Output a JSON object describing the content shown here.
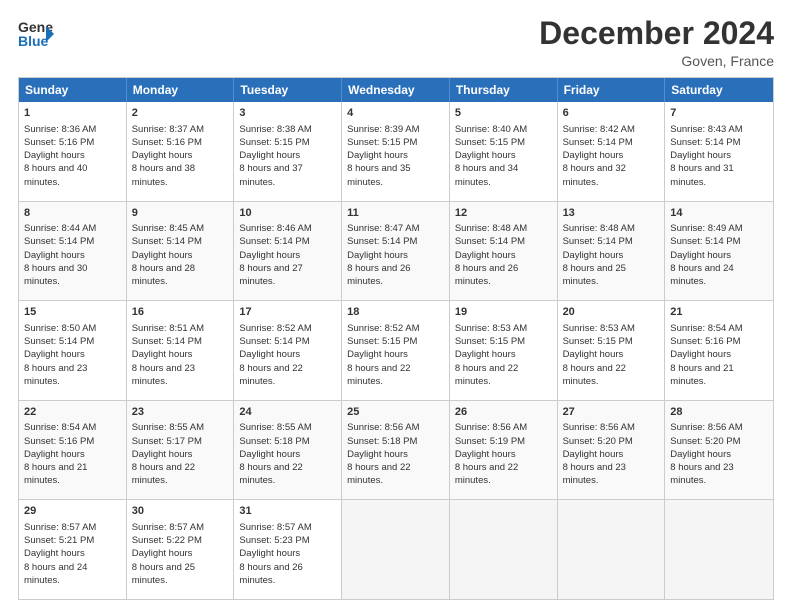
{
  "header": {
    "logo_line1": "General",
    "logo_line2": "Blue",
    "title": "December 2024",
    "location": "Goven, France"
  },
  "days": [
    "Sunday",
    "Monday",
    "Tuesday",
    "Wednesday",
    "Thursday",
    "Friday",
    "Saturday"
  ],
  "weeks": [
    [
      {
        "day": "1",
        "sun": "8:36 AM",
        "set": "5:16 PM",
        "daylight": "8 hours and 40 minutes."
      },
      {
        "day": "2",
        "sun": "8:37 AM",
        "set": "5:16 PM",
        "daylight": "8 hours and 38 minutes."
      },
      {
        "day": "3",
        "sun": "8:38 AM",
        "set": "5:15 PM",
        "daylight": "8 hours and 37 minutes."
      },
      {
        "day": "4",
        "sun": "8:39 AM",
        "set": "5:15 PM",
        "daylight": "8 hours and 35 minutes."
      },
      {
        "day": "5",
        "sun": "8:40 AM",
        "set": "5:15 PM",
        "daylight": "8 hours and 34 minutes."
      },
      {
        "day": "6",
        "sun": "8:42 AM",
        "set": "5:14 PM",
        "daylight": "8 hours and 32 minutes."
      },
      {
        "day": "7",
        "sun": "8:43 AM",
        "set": "5:14 PM",
        "daylight": "8 hours and 31 minutes."
      }
    ],
    [
      {
        "day": "8",
        "sun": "8:44 AM",
        "set": "5:14 PM",
        "daylight": "8 hours and 30 minutes."
      },
      {
        "day": "9",
        "sun": "8:45 AM",
        "set": "5:14 PM",
        "daylight": "8 hours and 28 minutes."
      },
      {
        "day": "10",
        "sun": "8:46 AM",
        "set": "5:14 PM",
        "daylight": "8 hours and 27 minutes."
      },
      {
        "day": "11",
        "sun": "8:47 AM",
        "set": "5:14 PM",
        "daylight": "8 hours and 26 minutes."
      },
      {
        "day": "12",
        "sun": "8:48 AM",
        "set": "5:14 PM",
        "daylight": "8 hours and 26 minutes."
      },
      {
        "day": "13",
        "sun": "8:48 AM",
        "set": "5:14 PM",
        "daylight": "8 hours and 25 minutes."
      },
      {
        "day": "14",
        "sun": "8:49 AM",
        "set": "5:14 PM",
        "daylight": "8 hours and 24 minutes."
      }
    ],
    [
      {
        "day": "15",
        "sun": "8:50 AM",
        "set": "5:14 PM",
        "daylight": "8 hours and 23 minutes."
      },
      {
        "day": "16",
        "sun": "8:51 AM",
        "set": "5:14 PM",
        "daylight": "8 hours and 23 minutes."
      },
      {
        "day": "17",
        "sun": "8:52 AM",
        "set": "5:14 PM",
        "daylight": "8 hours and 22 minutes."
      },
      {
        "day": "18",
        "sun": "8:52 AM",
        "set": "5:15 PM",
        "daylight": "8 hours and 22 minutes."
      },
      {
        "day": "19",
        "sun": "8:53 AM",
        "set": "5:15 PM",
        "daylight": "8 hours and 22 minutes."
      },
      {
        "day": "20",
        "sun": "8:53 AM",
        "set": "5:15 PM",
        "daylight": "8 hours and 22 minutes."
      },
      {
        "day": "21",
        "sun": "8:54 AM",
        "set": "5:16 PM",
        "daylight": "8 hours and 21 minutes."
      }
    ],
    [
      {
        "day": "22",
        "sun": "8:54 AM",
        "set": "5:16 PM",
        "daylight": "8 hours and 21 minutes."
      },
      {
        "day": "23",
        "sun": "8:55 AM",
        "set": "5:17 PM",
        "daylight": "8 hours and 22 minutes."
      },
      {
        "day": "24",
        "sun": "8:55 AM",
        "set": "5:18 PM",
        "daylight": "8 hours and 22 minutes."
      },
      {
        "day": "25",
        "sun": "8:56 AM",
        "set": "5:18 PM",
        "daylight": "8 hours and 22 minutes."
      },
      {
        "day": "26",
        "sun": "8:56 AM",
        "set": "5:19 PM",
        "daylight": "8 hours and 22 minutes."
      },
      {
        "day": "27",
        "sun": "8:56 AM",
        "set": "5:20 PM",
        "daylight": "8 hours and 23 minutes."
      },
      {
        "day": "28",
        "sun": "8:56 AM",
        "set": "5:20 PM",
        "daylight": "8 hours and 23 minutes."
      }
    ],
    [
      {
        "day": "29",
        "sun": "8:57 AM",
        "set": "5:21 PM",
        "daylight": "8 hours and 24 minutes."
      },
      {
        "day": "30",
        "sun": "8:57 AM",
        "set": "5:22 PM",
        "daylight": "8 hours and 25 minutes."
      },
      {
        "day": "31",
        "sun": "8:57 AM",
        "set": "5:23 PM",
        "daylight": "8 hours and 26 minutes."
      },
      null,
      null,
      null,
      null
    ]
  ]
}
